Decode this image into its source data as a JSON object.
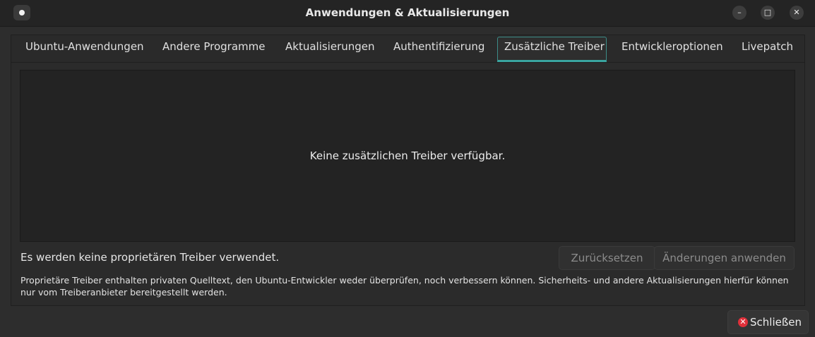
{
  "window": {
    "title": "Anwendungen & Aktualisierungen",
    "minimize_glyph": "–",
    "maximize_glyph": "□",
    "close_glyph": "✕"
  },
  "tabs": [
    {
      "label": "Ubuntu-Anwendungen"
    },
    {
      "label": "Andere Programme"
    },
    {
      "label": "Aktualisierungen"
    },
    {
      "label": "Authentifizierung"
    },
    {
      "label": "Zusätzliche Treiber",
      "active": true
    },
    {
      "label": "Entwickleroptionen"
    },
    {
      "label": "Livepatch"
    }
  ],
  "drivers": {
    "empty_message": "Keine zusätzlichen Treiber verfügbar.",
    "status": "Es werden keine proprietären Treiber verwendet.",
    "revert_label": "Zurücksetzen",
    "apply_label": "Änderungen anwenden",
    "note": "Proprietäre Treiber enthalten privaten Quelltext, den Ubuntu-Entwickler weder überprüfen, noch verbessern können. Sicherheits- und andere Aktualisierungen hierfür können nur vom Treiberanbieter bereitgestellt werden."
  },
  "footer": {
    "close_label": "Schließen",
    "close_icon_glyph": "✕"
  },
  "colors": {
    "accent": "#3aa5a0",
    "close_icon": "#e0303a"
  }
}
